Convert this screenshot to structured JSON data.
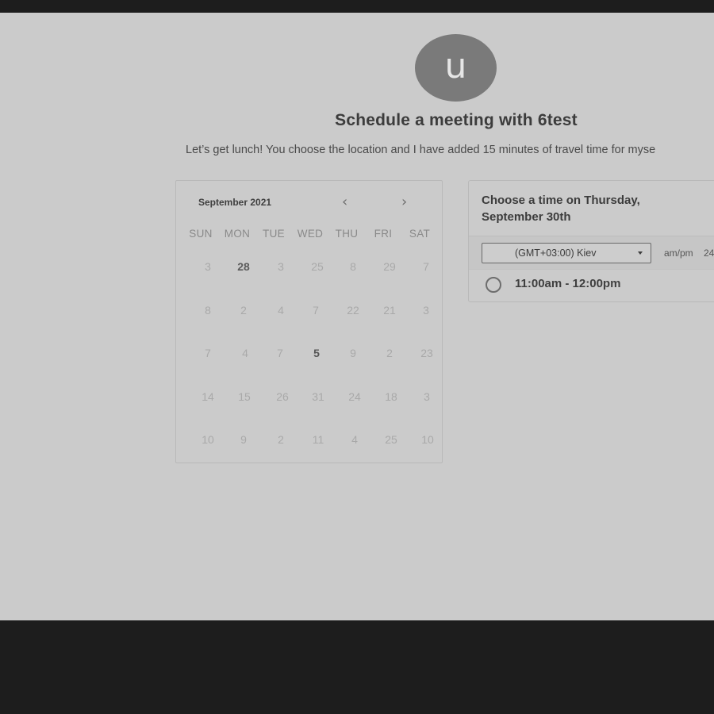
{
  "host": {
    "avatar_letter": "u",
    "title": "Schedule a meeting with 6test",
    "description": "Let’s get lunch! You choose the location and I have added 15 minutes of travel time for myse"
  },
  "calendar": {
    "month_label": "September 2021",
    "prev_icon": "chevron-left-icon",
    "next_icon": "chevron-right-icon",
    "weekdays": [
      "SUN",
      "MON",
      "TUE",
      "WED",
      "THU",
      "FRI",
      "SAT"
    ],
    "weeks": [
      [
        "3",
        "28",
        "3",
        "25",
        "8",
        "29",
        "7"
      ],
      [
        "8",
        "2",
        "4",
        "7",
        "22",
        "21",
        "3"
      ],
      [
        "7",
        "4",
        "7",
        "5",
        "9",
        "2",
        "23"
      ],
      [
        "14",
        "15",
        "26",
        "31",
        "24",
        "18",
        "3"
      ],
      [
        "10",
        "9",
        "2",
        "11",
        "4",
        "25",
        "10"
      ]
    ]
  },
  "time_picker": {
    "heading": "Choose a time on Thursday, September 30th",
    "timezone": "(GMT+03:00) Kiev",
    "format_ampm": "am/pm",
    "format_24": "24",
    "slots": [
      "11:00am - 12:00pm"
    ]
  },
  "colors": {
    "page_bg": "#cbcbcb",
    "frame_bg": "#1d1d1d",
    "avatar_bg": "#7a7a7a"
  }
}
